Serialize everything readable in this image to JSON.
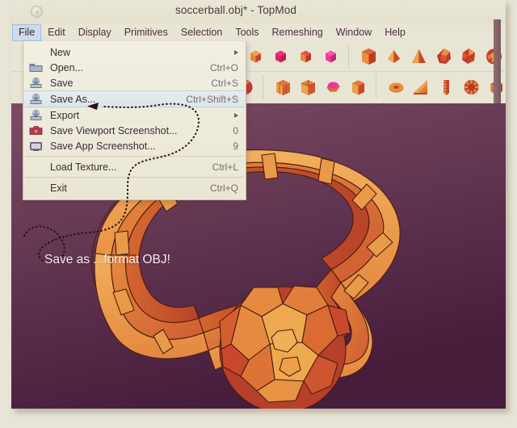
{
  "window": {
    "title": "soccerball.obj* - TopMod",
    "orb_icon": "app-orb-icon"
  },
  "menubar": {
    "items": [
      {
        "label": "File",
        "active": true
      },
      {
        "label": "Edit",
        "active": false
      },
      {
        "label": "Display",
        "active": false
      },
      {
        "label": "Primitives",
        "active": false
      },
      {
        "label": "Selection",
        "active": false
      },
      {
        "label": "Tools",
        "active": false
      },
      {
        "label": "Remeshing",
        "active": false
      },
      {
        "label": "Window",
        "active": false
      },
      {
        "label": "Help",
        "active": false
      }
    ]
  },
  "file_menu": {
    "items": [
      {
        "label": "New",
        "shortcut": "",
        "icon": "",
        "submenu": true,
        "selected": false
      },
      {
        "label": "Open...",
        "shortcut": "Ctrl+O",
        "icon": "folder-icon",
        "submenu": false,
        "selected": false
      },
      {
        "label": "Save",
        "shortcut": "Ctrl+S",
        "icon": "save-icon",
        "submenu": false,
        "selected": false
      },
      {
        "label": "Save As...",
        "shortcut": "Ctrl+Shift+S",
        "icon": "save-as-icon",
        "submenu": false,
        "selected": true
      },
      {
        "label": "Export",
        "shortcut": "",
        "icon": "export-icon",
        "submenu": true,
        "selected": false
      },
      {
        "label": "Save Viewport Screenshot...",
        "shortcut": "0",
        "icon": "camera-icon",
        "submenu": false,
        "selected": false
      },
      {
        "label": "Save App Screenshot...",
        "shortcut": "9",
        "icon": "monitor-icon",
        "submenu": false,
        "selected": false
      },
      {
        "separator": true
      },
      {
        "label": "Load Texture...",
        "shortcut": "Ctrl+L",
        "icon": "",
        "submenu": false,
        "selected": false
      },
      {
        "separator": true
      },
      {
        "label": "Exit",
        "shortcut": "Ctrl+Q",
        "icon": "",
        "submenu": false,
        "selected": false
      }
    ]
  },
  "toolbar": {
    "row1": [
      {
        "icon": "primitive-cube-orange-icon"
      },
      {
        "icon": "primitive-cube-magenta-icon"
      },
      {
        "icon": "primitive-cube-red-icon"
      },
      {
        "icon": "primitive-cube-pink-icon"
      },
      {
        "separator": true
      },
      {
        "icon": "primitive-hexahedron-icon"
      },
      {
        "icon": "primitive-octahedron-icon"
      },
      {
        "icon": "primitive-tetrahedron-icon"
      },
      {
        "icon": "primitive-dodecahedron-icon"
      },
      {
        "icon": "primitive-icosahedron-icon"
      },
      {
        "icon": "primitive-soccerball-icon"
      }
    ],
    "row2": [
      {
        "icon": "primitive-sphere-icon"
      },
      {
        "separator": true
      },
      {
        "icon": "primitive-cube-subdivided-icon"
      },
      {
        "icon": "primitive-cube-triangulated-icon"
      },
      {
        "icon": "primitive-dome-icon"
      },
      {
        "icon": "primitive-box-icon"
      },
      {
        "separator": true
      },
      {
        "icon": "primitive-torus-icon"
      },
      {
        "icon": "primitive-wedge-icon"
      },
      {
        "icon": "primitive-column-icon"
      },
      {
        "icon": "primitive-spiral-icon"
      },
      {
        "icon": "primitive-prism-icon"
      }
    ]
  },
  "viewport": {
    "model_name": "soccerball-rind-model",
    "background_top": "#7d4a63",
    "background_bottom": "#4a1f3f",
    "face_light": "#f0a855",
    "face_mid": "#e07a3c",
    "face_dark": "#c0452f"
  },
  "annotation": {
    "text": "Save as ...format OBJ!",
    "arrow_target": "Save As...",
    "color": "#f2eef0"
  }
}
